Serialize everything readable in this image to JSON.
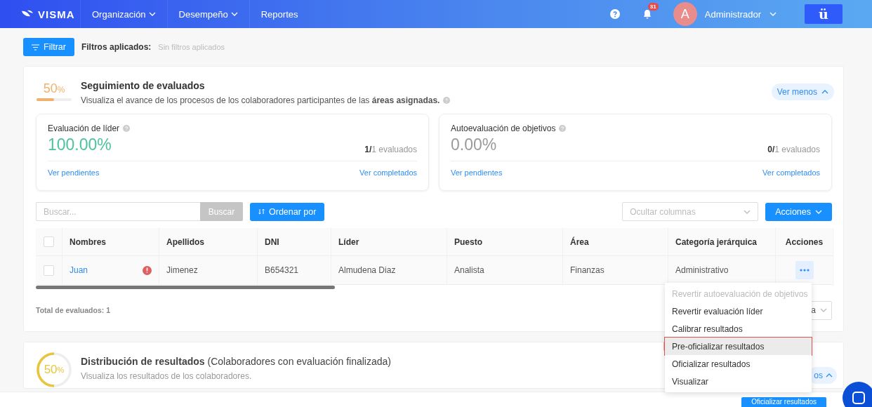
{
  "header": {
    "logo": "VISMA",
    "nav": [
      {
        "label": "Organización",
        "dropdown": true
      },
      {
        "label": "Desempeño",
        "dropdown": true
      },
      {
        "label": "Reportes",
        "dropdown": false
      }
    ],
    "notifications": "31",
    "avatar": "A",
    "user": "Administrador",
    "app_button": "ü"
  },
  "filter_bar": {
    "button": "Filtrar",
    "label": "Filtros aplicados:",
    "value": "Sin filtros aplicados"
  },
  "tracking": {
    "percent": "50",
    "unit": "%",
    "level": 0.5,
    "title": "Seguimiento de evaluados",
    "description": "Visualiza el avance de los procesos de los colaboradores participantes de las **áreas asignadas.**",
    "toggle": "Ver menos",
    "stats": [
      {
        "title": "Evaluación de líder",
        "value": "100.00%",
        "color": "#4cc29e",
        "count": "**1/**1 evaluados",
        "pending": "Ver pendientes",
        "completed": "Ver completados"
      },
      {
        "title": "Autoevaluación de objetivos",
        "value": "0.00%",
        "color": "#9a9a9a",
        "count": "**0/**1 evaluados",
        "pending": "Ver pendientes",
        "completed": "Ver completados"
      }
    ],
    "search": {
      "placeholder": "Buscar...",
      "button": "Buscar"
    },
    "sort_button": "Ordenar por",
    "columns_select": {
      "placeholder": "Ocultar columnas"
    },
    "actions_button": "Acciones",
    "table": {
      "select_all": {
        "checked": false
      },
      "columns": [
        "Nombres",
        "Apellidos",
        "DNI",
        "Líder",
        "Puesto",
        "Área",
        "Categoría jerárquica",
        "Acciones"
      ],
      "rows": [
        {
          "checked": false,
          "warning": true,
          "cells": [
            "Juan",
            "Jimenez",
            "B654321",
            "Almudena Diaz",
            "Analista",
            "Finanzas",
            "Administrativo"
          ]
        }
      ]
    },
    "total": "Total de evaluados: 1",
    "pagination_partial": "a"
  },
  "distribution": {
    "percent": "50",
    "unit": "%",
    "level": 0.5,
    "title": "**Distribución de resultados** (Colaboradores con evaluación finalizada)",
    "description": "Visualiza los resultados de los colaboradores.",
    "toggle_partial": "os"
  },
  "action_menu": {
    "items": [
      {
        "label": "Revertir autoevaluación de objetivos",
        "disabled": true,
        "selected": false
      },
      {
        "label": "Revertir evaluación líder",
        "disabled": false,
        "selected": false
      },
      {
        "label": "Calibrar resultados",
        "disabled": false,
        "selected": false
      },
      {
        "label": "Pre-oficializar resultados",
        "disabled": false,
        "selected": true
      },
      {
        "label": "Oficializar resultados",
        "disabled": false,
        "selected": false
      },
      {
        "label": "Visualizar",
        "disabled": false,
        "selected": false
      }
    ]
  },
  "footer": {
    "button": "Oficializar resultados"
  }
}
